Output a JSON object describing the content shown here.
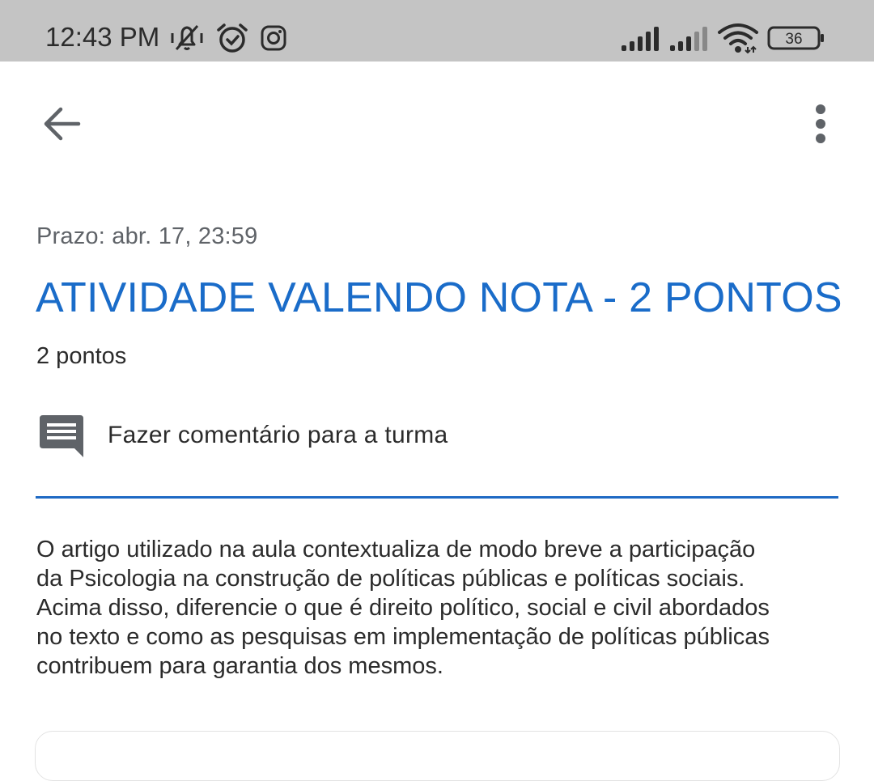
{
  "status_bar": {
    "time": "12:43 PM",
    "battery": "36",
    "icons": [
      "vibrate-muted-icon",
      "alarm-icon",
      "instagram-icon",
      "signal-icon",
      "signal-icon",
      "wifi-icon",
      "battery-icon"
    ]
  },
  "app_bar": {
    "back_icon": "arrow-back-icon",
    "menu_icon": "more-vert-icon"
  },
  "assignment": {
    "due": "Prazo: abr. 17, 23:59",
    "title": "ATIVIDADE VALENDO NOTA - 2 PONTOS",
    "points": "2 pontos",
    "comment_label": "Fazer comentário para a turma",
    "description_lines": [
      "O artigo utilizado na aula contextualiza de modo breve a participação",
      "da Psicologia na construção de políticas públicas e políticas sociais.",
      "Acima disso, diferencie o que é direito político, social e civil abordados",
      "no texto e como as pesquisas em implementação de políticas públicas",
      "contribuem para garantia dos mesmos."
    ]
  },
  "colors": {
    "accent": "#1a6cc9",
    "divider": "#1f6ac4",
    "status_bar": "#c4c4c4",
    "text": "#2b2b2b",
    "secondary_text": "#5f6368"
  }
}
